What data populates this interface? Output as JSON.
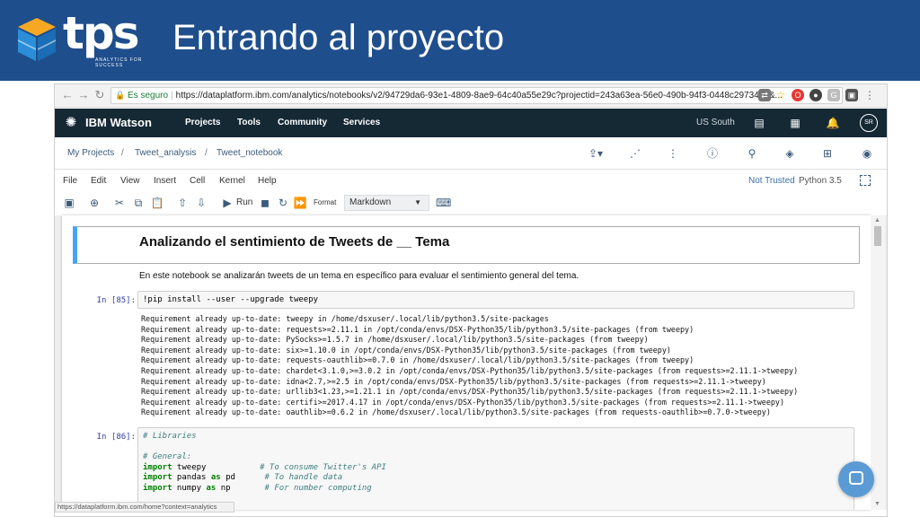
{
  "slide": {
    "logo_text": "tps",
    "logo_subtitle": "ANALYTICS FOR SUCCESS",
    "title": "Entrando al proyecto"
  },
  "browser": {
    "secure_label": "Es seguro",
    "url": "https://dataplatform.ibm.com/analytics/notebooks/v2/94729da6-93e1-4809-8ae9-64c40a55e29c?projectid=243a63ea-56e0-490b-94f3-0448c29734be&...",
    "status_url": "https://dataplatform.ibm.com/home?context=analytics"
  },
  "watson_nav": {
    "brand": "IBM Watson",
    "links": [
      "Projects",
      "Tools",
      "Community",
      "Services"
    ],
    "region": "US South",
    "avatar_initials": "SR"
  },
  "breadcrumb": {
    "items": [
      "My Projects",
      "Tweet_analysis",
      "Tweet_notebook"
    ],
    "separator": "/"
  },
  "jupyter_menu": {
    "items": [
      "File",
      "Edit",
      "View",
      "Insert",
      "Cell",
      "Kernel",
      "Help"
    ],
    "trust_label": "Not Trusted",
    "kernel_name": "Python 3.5"
  },
  "toolbar": {
    "run_label": "Run",
    "format_label": "Format",
    "cell_type": "Markdown"
  },
  "notebook": {
    "markdown_title": "Analizando el sentimiento de Tweets de __ Tema",
    "markdown_text": "En este notebook se analizarán tweets de un tema en específico para evaluar el sentimiento general del tema.",
    "cell1": {
      "prompt": "In [85]:",
      "code": "!pip install --user --upgrade tweepy",
      "output": [
        "Requirement already up-to-date: tweepy in /home/dsxuser/.local/lib/python3.5/site-packages",
        "Requirement already up-to-date: requests>=2.11.1 in /opt/conda/envs/DSX-Python35/lib/python3.5/site-packages (from tweepy)",
        "Requirement already up-to-date: PySocks>=1.5.7 in /home/dsxuser/.local/lib/python3.5/site-packages (from tweepy)",
        "Requirement already up-to-date: six>=1.10.0 in /opt/conda/envs/DSX-Python35/lib/python3.5/site-packages (from tweepy)",
        "Requirement already up-to-date: requests-oauthlib>=0.7.0 in /home/dsxuser/.local/lib/python3.5/site-packages (from tweepy)",
        "Requirement already up-to-date: chardet<3.1.0,>=3.0.2 in /opt/conda/envs/DSX-Python35/lib/python3.5/site-packages (from requests>=2.11.1->tweepy)",
        "Requirement already up-to-date: idna<2.7,>=2.5 in /opt/conda/envs/DSX-Python35/lib/python3.5/site-packages (from requests>=2.11.1->tweepy)",
        "Requirement already up-to-date: urllib3<1.23,>=1.21.1 in /opt/conda/envs/DSX-Python35/lib/python3.5/site-packages (from requests>=2.11.1->tweepy)",
        "Requirement already up-to-date: certifi>=2017.4.17 in /opt/conda/envs/DSX-Python35/lib/python3.5/site-packages (from requests>=2.11.1->tweepy)",
        "Requirement already up-to-date: oauthlib>=0.6.2 in /home/dsxuser/.local/lib/python3.5/site-packages (from requests-oauthlib>=0.7.0->tweepy)"
      ]
    },
    "cell2": {
      "prompt": "In [86]:",
      "comment_libraries": "# Libraries",
      "comment_general": "# General:",
      "lines": [
        {
          "kw": "import",
          "mod": " tweepy",
          "pad": "           ",
          "comment": "# To consume Twitter's API"
        },
        {
          "kw": "import",
          "mod": " pandas ",
          "as": "as",
          "alias": " pd",
          "pad": "      ",
          "comment": "# To handle data"
        },
        {
          "kw": "import",
          "mod": " numpy ",
          "as": "as",
          "alias": " np",
          "pad": "       ",
          "comment": "# For number computing"
        }
      ]
    }
  },
  "colors": {
    "slide_header": "#1f4e8c",
    "watson_nav": "#152935",
    "markdown_accent": "#42a5f5",
    "chat_bubble": "#5b9bd5"
  }
}
